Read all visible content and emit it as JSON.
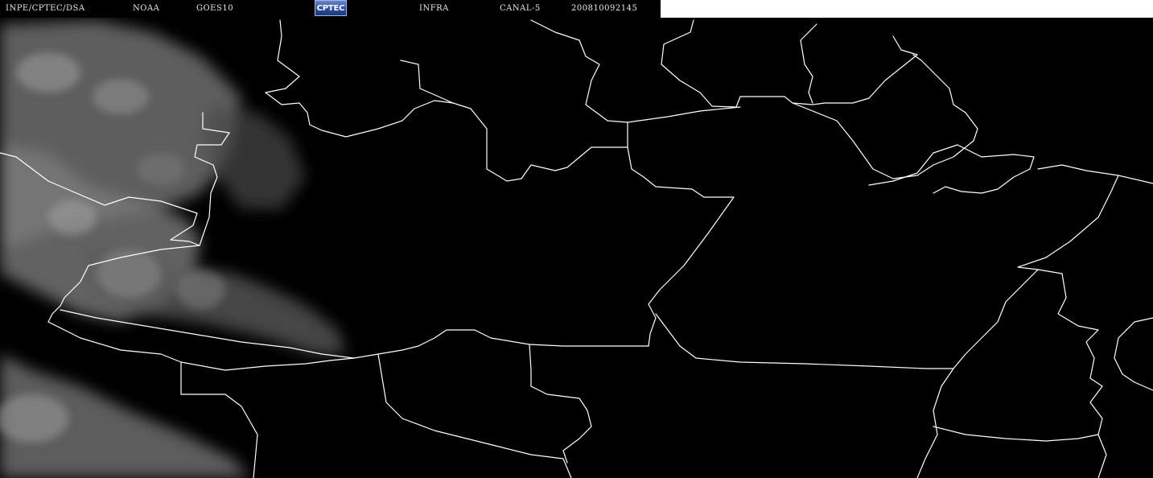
{
  "header": {
    "agency": "INPE/CPTEC/DSA",
    "org": "NOAA",
    "satellite": "GOES10",
    "logo_text": "CPTEC",
    "band": "INFRA",
    "channel": "CANAL-5",
    "timestamp": "200810092145"
  },
  "map": {
    "background_color": "#000000",
    "border_color": "#ffffff",
    "cloud_color": "#8a8a8a"
  }
}
